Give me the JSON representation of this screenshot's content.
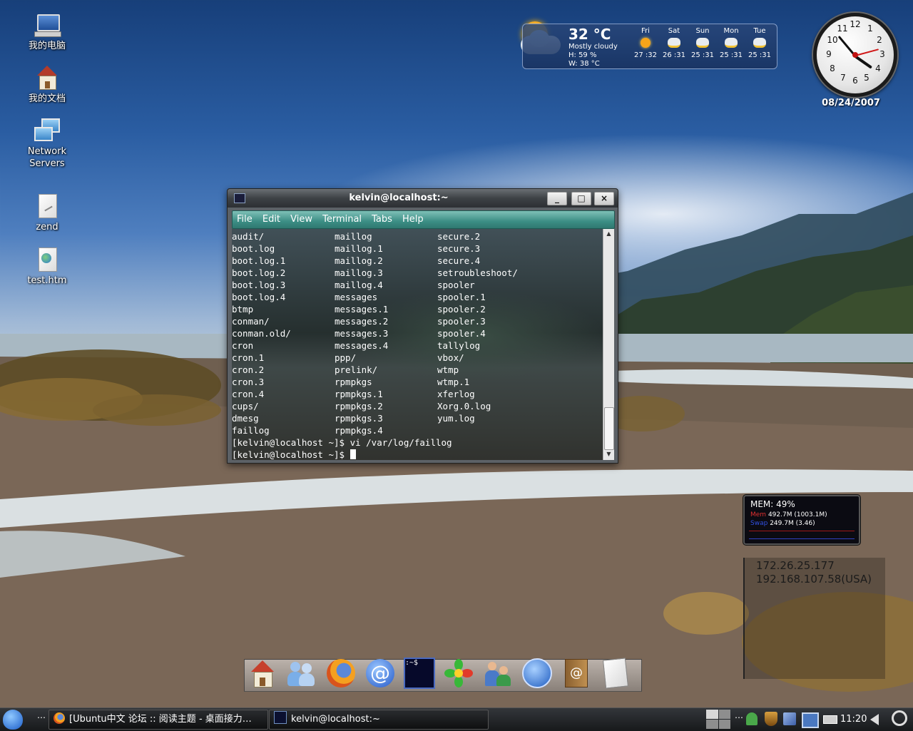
{
  "desktop_icons": [
    {
      "label": "我的电脑",
      "icon": "computer-icon"
    },
    {
      "label": "我的文档",
      "icon": "home-folder-icon"
    },
    {
      "label": "Network Servers",
      "icon": "network-icon"
    },
    {
      "label": "zend",
      "icon": "file-icon"
    },
    {
      "label": "test.htm",
      "icon": "html-file-icon"
    }
  ],
  "weather": {
    "temp": "32 °C",
    "condition": "Mostly cloudy",
    "humidity": "H: 59 %",
    "wind": "W: 38 °C",
    "days": [
      {
        "name": "Fri",
        "temps": "27 :32"
      },
      {
        "name": "Sat",
        "temps": "26 :31"
      },
      {
        "name": "Sun",
        "temps": "25 :31"
      },
      {
        "name": "Mon",
        "temps": "25 :31"
      },
      {
        "name": "Tue",
        "temps": "25 :31"
      }
    ]
  },
  "clock": {
    "date": "08/24/2007",
    "numbers": [
      "12",
      "1",
      "2",
      "3",
      "4",
      "5",
      "6",
      "7",
      "8",
      "9",
      "10",
      "11"
    ]
  },
  "terminal": {
    "title": "kelvin@localhost:~",
    "buttons": {
      "minimize": "_",
      "maximize": "□",
      "close": "×"
    },
    "menu": [
      "File",
      "Edit",
      "View",
      "Terminal",
      "Tabs",
      "Help"
    ],
    "col1": [
      "audit/",
      "boot.log",
      "boot.log.1",
      "boot.log.2",
      "boot.log.3",
      "boot.log.4",
      "btmp",
      "conman/",
      "conman.old/",
      "cron",
      "cron.1",
      "cron.2",
      "cron.3",
      "cron.4",
      "cups/",
      "dmesg",
      "faillog"
    ],
    "col2": [
      "maillog",
      "maillog.1",
      "maillog.2",
      "maillog.3",
      "maillog.4",
      "messages",
      "messages.1",
      "messages.2",
      "messages.3",
      "messages.4",
      "ppp/",
      "prelink/",
      "rpmpkgs",
      "rpmpkgs.1",
      "rpmpkgs.2",
      "rpmpkgs.3",
      "rpmpkgs.4"
    ],
    "col3": [
      "secure.2",
      "secure.3",
      "secure.4",
      "setroubleshoot/",
      "spooler",
      "spooler.1",
      "spooler.2",
      "spooler.3",
      "spooler.4",
      "tallylog",
      "vbox/",
      "wtmp",
      "wtmp.1",
      "xferlog",
      "Xorg.0.log",
      "yum.log"
    ],
    "prompt1": "[kelvin@localhost ~]$ vi /var/log/faillog",
    "prompt2": "[kelvin@localhost ~]$ "
  },
  "mem": {
    "title": "MEM:  49%",
    "row1_label": "Mem",
    "row1_value": "492.7M (1003.1M)",
    "row2_label": "Swap",
    "row2_value": "249.7M (3.46)"
  },
  "network": {
    "ip1": "172.26.25.177",
    "ip2": "192.168.107.58(USA)"
  },
  "dock": [
    "home-icon",
    "messenger-icon",
    "firefox-icon",
    "email-icon",
    "terminal-icon",
    "icq-icon",
    "users-icon",
    "network-globe-icon",
    "address-book-icon",
    "document-icon"
  ],
  "dock_terminal_glyph": ":~$",
  "taskbar": {
    "tasks": [
      {
        "label": "[Ubuntu中文 论坛 :: 阅读主题 - 桌面接力…"
      },
      {
        "label": "kelvin@localhost:~"
      }
    ],
    "time": "11:20",
    "colors": {
      "accent": "#2f7870",
      "desktop_sky": "#2a5da2"
    }
  }
}
